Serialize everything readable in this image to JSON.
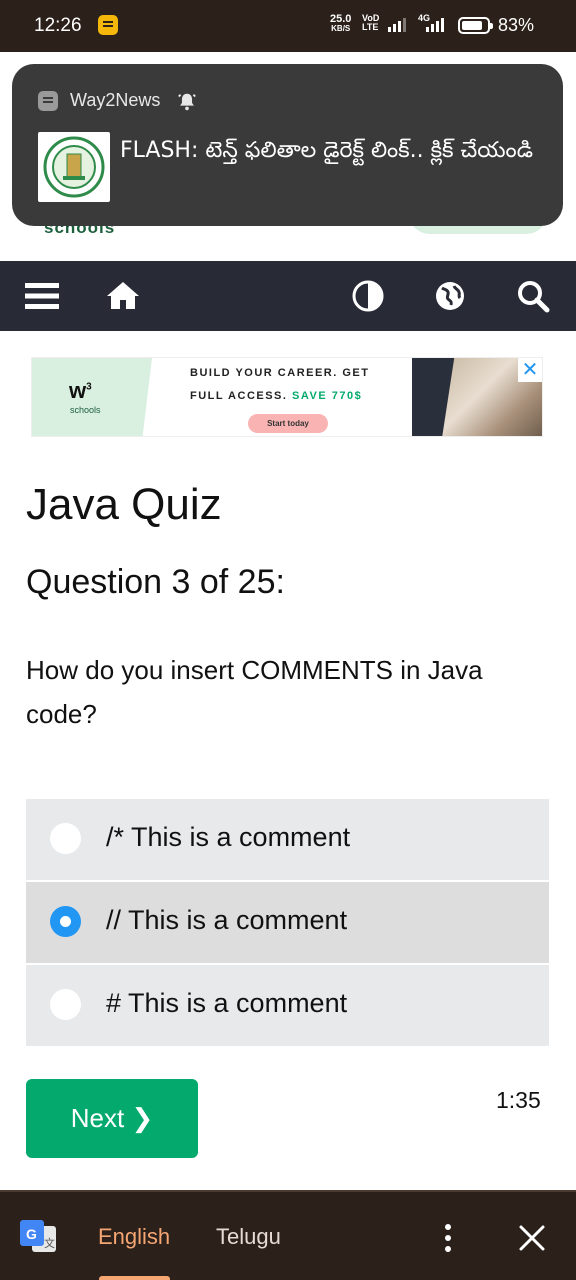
{
  "status_bar": {
    "time": "12:26",
    "net_speed_value": "25.0",
    "net_speed_unit": "KB/S",
    "sim1_label": "VoD LTE",
    "sim2_label": "4G",
    "battery": "83%"
  },
  "page_peek": {
    "brand_text": "schools"
  },
  "notification": {
    "app_name": "Way2News",
    "message": "FLASH: టెన్త్ ఫలితాల డైరెక్ట్ లింక్.. క్లిక్ చేయండి"
  },
  "navbar": {
    "icons": [
      "menu-icon",
      "home-icon",
      "contrast-icon",
      "globe-icon",
      "search-icon"
    ]
  },
  "ad": {
    "logo": "w",
    "logo_sup": "3",
    "logo_sub": "schools",
    "line1": "BUILD YOUR CAREER. GET",
    "line2_prefix": "FULL ACCESS. ",
    "line2_highlight": "SAVE 770$",
    "cta": "Start today",
    "close": "✕"
  },
  "quiz": {
    "title": "Java Quiz",
    "question_number": "Question 3 of 25:",
    "question": "How do you insert COMMENTS in Java code?",
    "options": [
      {
        "label": "/* This is a comment",
        "selected": false
      },
      {
        "label": "// This is a comment",
        "selected": true
      },
      {
        "label": "# This is a comment",
        "selected": false
      }
    ],
    "next_label": "Next ❯",
    "timer": "1:35"
  },
  "translate_bar": {
    "lang_source": "English",
    "lang_target": "Telugu"
  },
  "colors": {
    "navbar_bg": "#282a35",
    "accent_green": "#04aa6d",
    "radio_selected": "#2196f3",
    "status_bg": "#2b201a",
    "translate_active": "#f5a673"
  }
}
